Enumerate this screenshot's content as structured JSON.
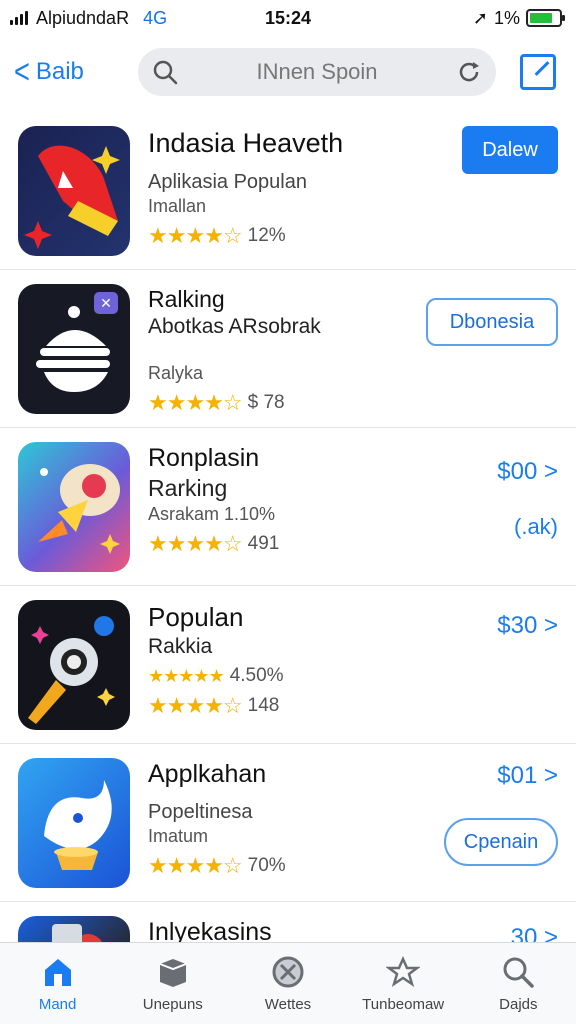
{
  "status_bar": {
    "carrier": "AlpiudndaR",
    "network": "4G",
    "time": "15:24",
    "battery_text": "1%",
    "battery_level": 0.8
  },
  "nav": {
    "back_label": "Baib",
    "search_text": "INnen Spoin"
  },
  "apps": [
    {
      "title": "Indasia Heaveth",
      "lines": [
        "Aplikasia Populan",
        "Imallan"
      ],
      "rating_text": "12%",
      "action": {
        "type": "solid",
        "label": "Dalew"
      },
      "icon": "rocket-app-icon"
    },
    {
      "title": "Ralking",
      "lines": [
        "Abotkas ARsobrak",
        "",
        "Ralyka"
      ],
      "rating_text": "$ 78",
      "action": {
        "type": "outline",
        "label": "Dbonesia"
      },
      "icon": "stacked-disc-app-icon"
    },
    {
      "title": "Ronplasin",
      "lines": [
        "Rarking",
        "Asrakam 1.10%"
      ],
      "rating_text": "491",
      "action": {
        "type": "price",
        "label": "$00 >",
        "sub": "(.ak)"
      },
      "icon": "space-rocket-app-icon"
    },
    {
      "title": "Populan",
      "lines": [
        "Rakkia"
      ],
      "rating_text": "4.50%",
      "rating_text_2": "148",
      "action": {
        "type": "price",
        "label": "$30 >"
      },
      "icon": "telescope-app-icon"
    },
    {
      "title": "Applkahan",
      "lines": [
        "Popeltinesa",
        "Imatum"
      ],
      "rating_text": "70%",
      "action": {
        "type": "price-outline",
        "label": "$01 >",
        "sub": "Cpenain"
      },
      "icon": "bird-app-icon"
    },
    {
      "title": "Inlyekasins",
      "lines": [],
      "rating_text": "",
      "action": {
        "type": "price",
        "label": "30 >"
      },
      "icon": "dark-app-icon"
    }
  ],
  "tabs": [
    {
      "label": "Mand",
      "icon": "home-icon",
      "active": true
    },
    {
      "label": "Unepuns",
      "icon": "box-icon",
      "active": false
    },
    {
      "label": "Wettes",
      "icon": "circle-x-icon",
      "active": false
    },
    {
      "label": "Tunbeomaw",
      "icon": "star-box-icon",
      "active": false
    },
    {
      "label": "Dajds",
      "icon": "search-icon",
      "active": false
    }
  ],
  "colors": {
    "accent": "#1a7cf0",
    "star": "#f5b300",
    "battery": "#22c03a"
  }
}
